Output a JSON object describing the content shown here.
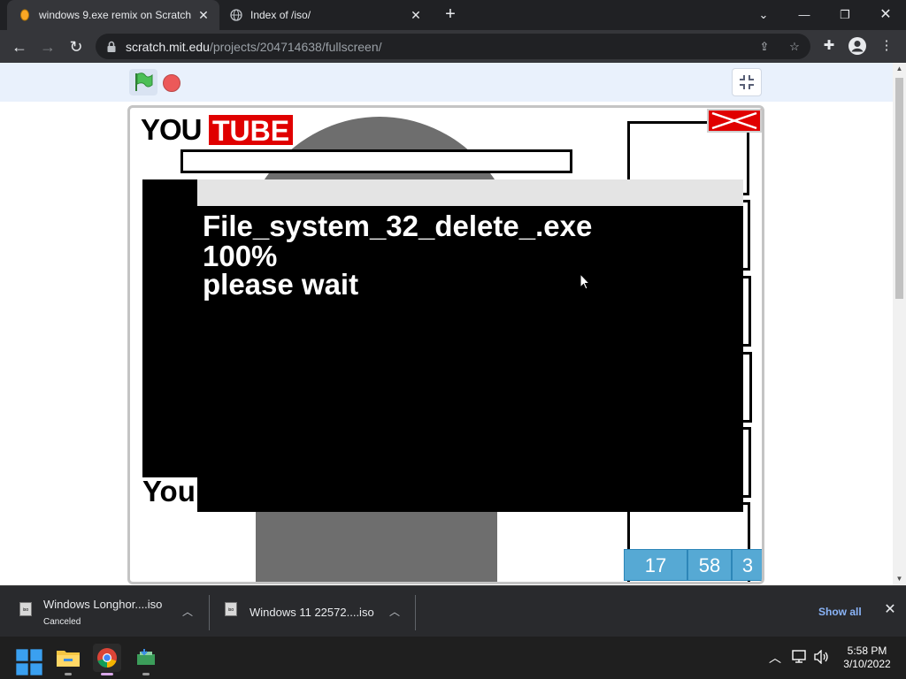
{
  "browser": {
    "tabs": [
      {
        "label": "windows 9.exe remix on Scratch",
        "active": true
      },
      {
        "label": "Index of /iso/",
        "active": false
      }
    ],
    "new_tab_symbol": "+",
    "url_host": "scratch.mit.edu",
    "url_path": "/projects/204714638/fullscreen/"
  },
  "stage": {
    "logo_you": "YOU",
    "logo_tube": "TUBE",
    "you_fragment": "You",
    "dialog": {
      "filename": "File_system_32_delete_.exe",
      "percent": "100%",
      "message": "please wait"
    },
    "counters": [
      "17",
      "58",
      "3"
    ]
  },
  "downloads": [
    {
      "name": "Windows Longhor....iso",
      "status": "Canceled"
    },
    {
      "name": "Windows 11 22572....iso",
      "status": ""
    }
  ],
  "download_file_type": "iso",
  "shelf": {
    "show_all": "Show all"
  },
  "clock": {
    "time": "5:58 PM",
    "date": "3/10/2022"
  },
  "colors": {
    "accent_red": "#e00000",
    "counter_blue": "#56a9d4",
    "scratch_bar": "#e9f1fc"
  },
  "icons": [
    "back-icon",
    "forward-icon",
    "reload-icon",
    "lock-icon",
    "share-icon",
    "star-icon",
    "extensions-icon",
    "profile-icon",
    "menu-icon",
    "green-flag-icon",
    "stop-icon",
    "exit-fullscreen-icon"
  ]
}
